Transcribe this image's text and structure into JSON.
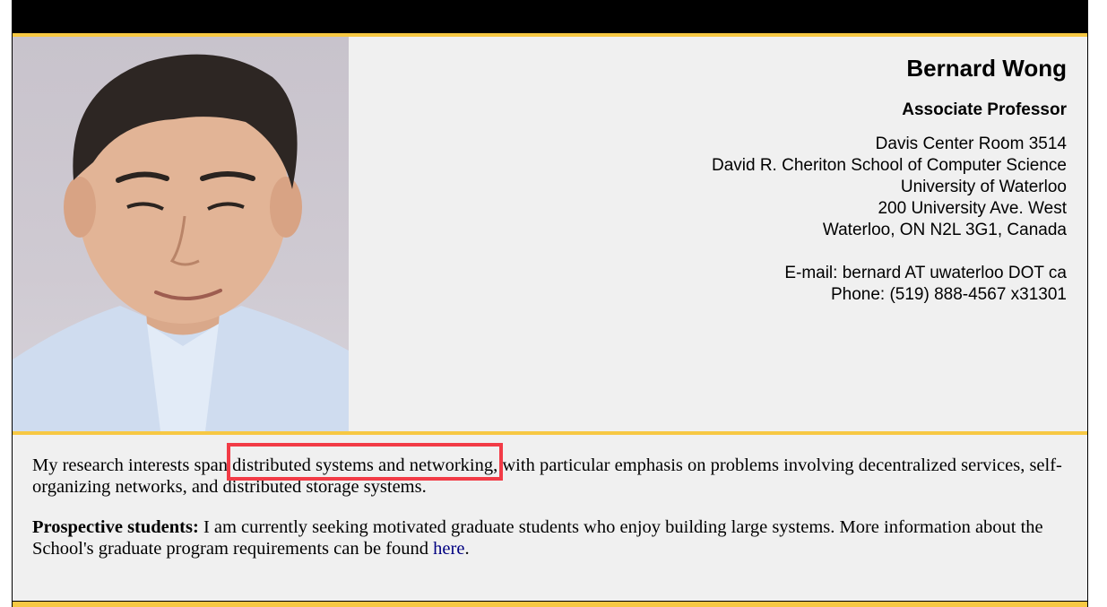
{
  "profile": {
    "name": "Bernard Wong",
    "title": "Associate Professor",
    "address": [
      "Davis Center Room 3514",
      "David R. Cheriton School of Computer Science",
      "University of Waterloo",
      "200 University Ave. West",
      "Waterloo, ON N2L 3G1, Canada"
    ],
    "email": "E-mail: bernard AT uwaterloo DOT ca",
    "phone": "Phone: (519) 888-4567 x31301"
  },
  "research": {
    "intro_prefix": "My research interests span",
    "intro_highlight": "distributed systems and networking,",
    "intro_suffix": "with particular emphasis on problems involving decentralized services, self-organizing networks, and distributed storage systems.",
    "prospective_label": "Prospective students:",
    "prospective_text": "I am currently seeking motivated graduate students who enjoy building large systems. More information about the School's graduate program requirements can be found",
    "link_text": "here",
    "link_trailer": "."
  },
  "colors": {
    "accent_gold": "#f7c843",
    "highlight_red": "#f23b46",
    "link_navy": "#000080",
    "background": "#f0f0f0"
  }
}
